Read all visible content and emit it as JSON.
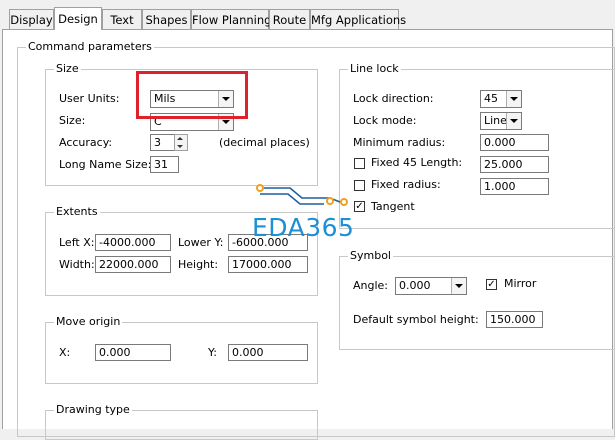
{
  "tabs": [
    "Display",
    "Design",
    "Text",
    "Shapes",
    "Flow Planning",
    "Route",
    "Mfg Applications"
  ],
  "command_parameters": {
    "title": "Command parameters",
    "size": {
      "title": "Size",
      "user_units_label": "User Units:",
      "user_units_value": "Mils",
      "size_label": "Size:",
      "size_value": "C",
      "accuracy_label": "Accuracy:",
      "accuracy_value": "3",
      "accuracy_hint": "(decimal places)",
      "long_name_label": "Long Name Size:",
      "long_name_value": "31"
    },
    "extents": {
      "title": "Extents",
      "left_x_label": "Left X:",
      "left_x_value": "-4000.000",
      "lower_y_label": "Lower Y:",
      "lower_y_value": "-6000.000",
      "width_label": "Width:",
      "width_value": "22000.000",
      "height_label": "Height:",
      "height_value": "17000.000"
    },
    "move_origin": {
      "title": "Move origin",
      "x_label": "X:",
      "x_value": "0.000",
      "y_label": "Y:",
      "y_value": "0.000"
    },
    "drawing_type": {
      "title": "Drawing type"
    },
    "line_lock": {
      "title": "Line lock",
      "lock_direction_label": "Lock direction:",
      "lock_direction_value": "45",
      "lock_mode_label": "Lock mode:",
      "lock_mode_value": "Line",
      "min_radius_label": "Minimum radius:",
      "min_radius_value": "0.000",
      "fixed45_label": "Fixed 45 Length:",
      "fixed45_checked": false,
      "fixed45_value": "25.000",
      "fixed_radius_label": "Fixed radius:",
      "fixed_radius_checked": false,
      "fixed_radius_value": "1.000",
      "tangent_label": "Tangent",
      "tangent_checked": true
    },
    "symbol": {
      "title": "Symbol",
      "angle_label": "Angle:",
      "angle_value": "0.000",
      "mirror_label": "Mirror",
      "mirror_checked": true,
      "default_height_label": "Default symbol height:",
      "default_height_value": "150.000"
    }
  },
  "watermark": {
    "text": "EDA365",
    "color": "#1d8fd6",
    "accent": "#f0a020"
  },
  "highlight_color": "#e0202a"
}
